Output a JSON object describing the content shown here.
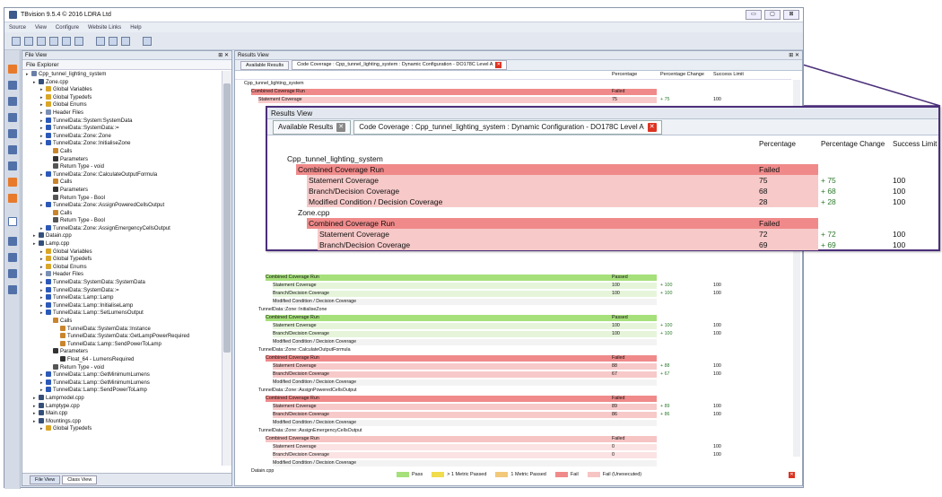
{
  "window": {
    "title": "TBvision 9.5.4 © 2016 LDRA Ltd",
    "buttons": [
      "▭",
      "▢",
      "⊠"
    ]
  },
  "menu": [
    "Source",
    "View",
    "Configure",
    "Website Links",
    "Help"
  ],
  "file_view": {
    "title": "File View",
    "explorer": "File Explorer",
    "tabs": [
      "File View",
      "Class View"
    ],
    "tree": [
      {
        "d": 0,
        "t": "Cpp_tunnel_lighting_system",
        "i": "project-icon",
        "c": "#6a7fa8"
      },
      {
        "d": 1,
        "t": "Zone.cpp",
        "i": "file-icon",
        "c": "#354f7a"
      },
      {
        "d": 2,
        "t": "Global Variables",
        "i": "folder-icon",
        "c": "#d9a628"
      },
      {
        "d": 2,
        "t": "Global Typedefs",
        "i": "folder-icon",
        "c": "#d9a628"
      },
      {
        "d": 2,
        "t": "Global Enums",
        "i": "folder-icon",
        "c": "#d9a628"
      },
      {
        "d": 2,
        "t": "Header Files",
        "i": "header-icon",
        "c": "#7b8fb3"
      },
      {
        "d": 2,
        "t": "TunnelData::System:SystemData",
        "i": "function-icon",
        "c": "#2c59b8"
      },
      {
        "d": 2,
        "t": "TunnelData::SystemData::=",
        "i": "function-icon",
        "c": "#2c59b8"
      },
      {
        "d": 2,
        "t": "TunnelData::Zone::Zone",
        "i": "function-icon",
        "c": "#2c59b8"
      },
      {
        "d": 2,
        "t": "TunnelData::Zone::InitialiseZone",
        "i": "function-icon",
        "c": "#2c59b8"
      },
      {
        "d": 3,
        "t": "Calls",
        "i": "calls-icon",
        "c": "#c9852c"
      },
      {
        "d": 3,
        "t": "Parameters",
        "i": "params-icon",
        "c": "#333"
      },
      {
        "d": 3,
        "t": "Return Type - void",
        "i": "return-icon",
        "c": "#555"
      },
      {
        "d": 2,
        "t": "TunnelData::Zone::CalculateOutputFormula",
        "i": "function-icon",
        "c": "#2c59b8"
      },
      {
        "d": 3,
        "t": "Calls",
        "i": "calls-icon",
        "c": "#c9852c"
      },
      {
        "d": 3,
        "t": "Parameters",
        "i": "params-icon",
        "c": "#333"
      },
      {
        "d": 3,
        "t": "Return Type - Bool",
        "i": "return-icon",
        "c": "#555"
      },
      {
        "d": 2,
        "t": "TunnelData::Zone::AssignPoweredCellsOutput",
        "i": "function-icon",
        "c": "#2c59b8"
      },
      {
        "d": 3,
        "t": "Calls",
        "i": "calls-icon",
        "c": "#c9852c"
      },
      {
        "d": 3,
        "t": "Return Type - Bool",
        "i": "return-icon",
        "c": "#555"
      },
      {
        "d": 2,
        "t": "TunnelData::Zone::AssignEmergencyCellsOutput",
        "i": "function-icon",
        "c": "#2c59b8"
      },
      {
        "d": 1,
        "t": "Datain.cpp",
        "i": "file-icon",
        "c": "#354f7a"
      },
      {
        "d": 1,
        "t": "Lamp.cpp",
        "i": "file-icon",
        "c": "#354f7a"
      },
      {
        "d": 2,
        "t": "Global Variables",
        "i": "folder-icon",
        "c": "#d9a628"
      },
      {
        "d": 2,
        "t": "Global Typedefs",
        "i": "folder-icon",
        "c": "#d9a628"
      },
      {
        "d": 2,
        "t": "Global Enums",
        "i": "folder-icon",
        "c": "#d9a628"
      },
      {
        "d": 2,
        "t": "Header Files",
        "i": "header-icon",
        "c": "#7b8fb3"
      },
      {
        "d": 2,
        "t": "TunnelData::SystemData::SystemData",
        "i": "function-icon",
        "c": "#2c59b8"
      },
      {
        "d": 2,
        "t": "TunnelData::SystemData::=",
        "i": "function-icon",
        "c": "#2c59b8"
      },
      {
        "d": 2,
        "t": "TunnelData::Lamp::Lamp",
        "i": "function-icon",
        "c": "#2c59b8"
      },
      {
        "d": 2,
        "t": "TunnelData::Lamp::InitialiseLamp",
        "i": "function-icon",
        "c": "#2c59b8"
      },
      {
        "d": 2,
        "t": "TunnelData::Lamp::SetLumensOutput",
        "i": "function-icon",
        "c": "#2c59b8"
      },
      {
        "d": 3,
        "t": "Calls",
        "i": "calls-icon",
        "c": "#c9852c"
      },
      {
        "d": 4,
        "t": "TunnelData::SystemData::Instance",
        "i": "call-icon",
        "c": "#c9852c"
      },
      {
        "d": 4,
        "t": "TunnelData::SystemData::GetLampPowerRequired",
        "i": "call-icon",
        "c": "#c9852c"
      },
      {
        "d": 4,
        "t": "TunnelData::Lamp::SendPowerToLamp",
        "i": "call-icon",
        "c": "#c9852c"
      },
      {
        "d": 3,
        "t": "Parameters",
        "i": "params-icon",
        "c": "#333"
      },
      {
        "d": 4,
        "t": "Float_64 - LumensRequired",
        "i": "param-icon",
        "c": "#333"
      },
      {
        "d": 3,
        "t": "Return Type - void",
        "i": "return-icon",
        "c": "#555"
      },
      {
        "d": 2,
        "t": "TunnelData::Lamp::GetMinimumLumens",
        "i": "function-icon",
        "c": "#2c59b8"
      },
      {
        "d": 2,
        "t": "TunnelData::Lamp::GetMinimumLumens",
        "i": "function-icon",
        "c": "#2c59b8"
      },
      {
        "d": 2,
        "t": "TunnelData::Lamp::SendPowerToLamp",
        "i": "function-icon",
        "c": "#2c59b8"
      },
      {
        "d": 1,
        "t": "Lampmodel.cpp",
        "i": "file-icon",
        "c": "#354f7a"
      },
      {
        "d": 1,
        "t": "Lamptype.cpp",
        "i": "file-icon",
        "c": "#354f7a"
      },
      {
        "d": 1,
        "t": "Main.cpp",
        "i": "file-icon",
        "c": "#354f7a"
      },
      {
        "d": 1,
        "t": "Mountings.cpp",
        "i": "file-icon",
        "c": "#354f7a"
      },
      {
        "d": 2,
        "t": "Global Typedefs",
        "i": "folder-icon",
        "c": "#d9a628"
      }
    ]
  },
  "results": {
    "title": "Results View",
    "tab_available": "Available Results",
    "tab_coverage": "Code Coverage : Cpp_tunnel_lighting_system : Dynamic Configuration - DO178C Level A",
    "col_percentage": "Percentage",
    "col_change": "Percentage Change",
    "col_limit": "Success Limit",
    "rows": [
      {
        "d": 0,
        "t": "Cpp_tunnel_lighting_system",
        "s": "none",
        "p": "",
        "c": "",
        "l": ""
      },
      {
        "d": 1,
        "t": "Combined Coverage Run",
        "s": "fail",
        "p": "Failed",
        "c": "",
        "l": ""
      },
      {
        "d": 2,
        "t": "Statement Coverage",
        "s": "failsub",
        "p": "75",
        "c": "+ 75",
        "l": "100"
      },
      {
        "d": 0,
        "t": "",
        "s": "none",
        "p": "",
        "c": "",
        "l": ""
      },
      {
        "d": 0,
        "t": "",
        "s": "none",
        "p": "",
        "c": "",
        "l": ""
      },
      {
        "d": 0,
        "t": "",
        "s": "none",
        "p": "",
        "c": "",
        "l": ""
      },
      {
        "d": 0,
        "t": "",
        "s": "none",
        "p": "",
        "c": "",
        "l": ""
      },
      {
        "d": 0,
        "t": "",
        "s": "none",
        "p": "",
        "c": "",
        "l": ""
      },
      {
        "d": 0,
        "t": "",
        "s": "none",
        "p": "",
        "c": "",
        "l": ""
      },
      {
        "d": 0,
        "t": "",
        "s": "none",
        "p": "",
        "c": "",
        "l": ""
      },
      {
        "d": 0,
        "t": "",
        "s": "none",
        "p": "",
        "c": "",
        "l": ""
      },
      {
        "d": 0,
        "t": "",
        "s": "none",
        "p": "",
        "c": "",
        "l": ""
      },
      {
        "d": 0,
        "t": "",
        "s": "none",
        "p": "",
        "c": "",
        "l": ""
      },
      {
        "d": 0,
        "t": "",
        "s": "none",
        "p": "",
        "c": "",
        "l": ""
      },
      {
        "d": 0,
        "t": "",
        "s": "none",
        "p": "",
        "c": "",
        "l": ""
      },
      {
        "d": 0,
        "t": "",
        "s": "none",
        "p": "",
        "c": "",
        "l": ""
      },
      {
        "d": 0,
        "t": "",
        "s": "none",
        "p": "",
        "c": "",
        "l": ""
      },
      {
        "d": 0,
        "t": "",
        "s": "none",
        "p": "",
        "c": "",
        "l": ""
      },
      {
        "d": 0,
        "t": "",
        "s": "none",
        "p": "",
        "c": "",
        "l": ""
      },
      {
        "d": 0,
        "t": "",
        "s": "none",
        "p": "",
        "c": "",
        "l": ""
      },
      {
        "d": 0,
        "t": "",
        "s": "none",
        "p": "",
        "c": "",
        "l": ""
      },
      {
        "d": 0,
        "t": "",
        "s": "none",
        "p": "",
        "c": "",
        "l": ""
      },
      {
        "d": 0,
        "t": "",
        "s": "none",
        "p": "",
        "c": "",
        "l": ""
      },
      {
        "d": 0,
        "t": "",
        "s": "none",
        "p": "",
        "c": "",
        "l": ""
      },
      {
        "d": 3,
        "t": "Combined Coverage Run",
        "s": "pass",
        "p": "Passed",
        "c": "",
        "l": ""
      },
      {
        "d": 4,
        "t": "Statement Coverage",
        "s": "passsub",
        "p": "100",
        "c": "+ 100",
        "l": "100"
      },
      {
        "d": 4,
        "t": "Branch/Decision Coverage",
        "s": "passsub",
        "p": "100",
        "c": "+ 100",
        "l": "100"
      },
      {
        "d": 4,
        "t": "Modified Condition / Decision Coverage",
        "s": "gray",
        "p": "",
        "c": "",
        "l": ""
      },
      {
        "d": 2,
        "t": "TunnelData::Zone::InitialiseZone",
        "s": "none",
        "p": "",
        "c": "",
        "l": ""
      },
      {
        "d": 3,
        "t": "Combined Coverage Run",
        "s": "pass",
        "p": "Passed",
        "c": "",
        "l": ""
      },
      {
        "d": 4,
        "t": "Statement Coverage",
        "s": "passsub",
        "p": "100",
        "c": "+ 100",
        "l": "100"
      },
      {
        "d": 4,
        "t": "Branch/Decision Coverage",
        "s": "passsub",
        "p": "100",
        "c": "+ 100",
        "l": "100"
      },
      {
        "d": 4,
        "t": "Modified Condition / Decision Coverage",
        "s": "gray",
        "p": "",
        "c": "",
        "l": ""
      },
      {
        "d": 2,
        "t": "TunnelData::Zone::CalculateOutputFormula",
        "s": "none",
        "p": "",
        "c": "",
        "l": ""
      },
      {
        "d": 3,
        "t": "Combined Coverage Run",
        "s": "fail",
        "p": "Failed",
        "c": "",
        "l": ""
      },
      {
        "d": 4,
        "t": "Statement Coverage",
        "s": "failsub",
        "p": "88",
        "c": "+ 88",
        "l": "100"
      },
      {
        "d": 4,
        "t": "Branch/Decision Coverage",
        "s": "failsub",
        "p": "67",
        "c": "+ 67",
        "l": "100"
      },
      {
        "d": 4,
        "t": "Modified Condition / Decision Coverage",
        "s": "gray",
        "p": "",
        "c": "",
        "l": ""
      },
      {
        "d": 2,
        "t": "TunnelData::Zone::AssignPoweredCellsOutput",
        "s": "none",
        "p": "",
        "c": "",
        "l": ""
      },
      {
        "d": 3,
        "t": "Combined Coverage Run",
        "s": "fail",
        "p": "Failed",
        "c": "",
        "l": ""
      },
      {
        "d": 4,
        "t": "Statement Coverage",
        "s": "failsub",
        "p": "89",
        "c": "+ 89",
        "l": "100"
      },
      {
        "d": 4,
        "t": "Branch/Decision Coverage",
        "s": "failsub",
        "p": "86",
        "c": "+ 86",
        "l": "100"
      },
      {
        "d": 4,
        "t": "Modified Condition / Decision Coverage",
        "s": "gray",
        "p": "",
        "c": "",
        "l": ""
      },
      {
        "d": 2,
        "t": "TunnelData::Zone::AssignEmergencyCellsOutput",
        "s": "none",
        "p": "",
        "c": "",
        "l": ""
      },
      {
        "d": 3,
        "t": "Combined Coverage Run",
        "s": "unexec",
        "p": "Failed",
        "c": "",
        "l": ""
      },
      {
        "d": 4,
        "t": "Statement Coverage",
        "s": "unexecsub",
        "p": "0",
        "c": "",
        "l": "100"
      },
      {
        "d": 4,
        "t": "Branch/Decision Coverage",
        "s": "unexecsub",
        "p": "0",
        "c": "",
        "l": "100"
      },
      {
        "d": 4,
        "t": "Modified Condition / Decision Coverage",
        "s": "gray",
        "p": "",
        "c": "",
        "l": ""
      },
      {
        "d": 1,
        "t": "Datain.cpp",
        "s": "none",
        "p": "",
        "c": "",
        "l": ""
      }
    ],
    "legend": [
      {
        "label": "Pass",
        "color": "#a6e07a"
      },
      {
        "label": "> 1 Metric Passed",
        "color": "#f0dc4c"
      },
      {
        "label": "1 Metric Passed",
        "color": "#f2c879"
      },
      {
        "label": "Fail",
        "color": "#f08a8a"
      },
      {
        "label": "Fail (Unexecuted)",
        "color": "#f7c4c4"
      }
    ]
  },
  "zoom": {
    "title": "Results View",
    "tab_available": "Available Results",
    "tab_coverage": "Code Coverage : Cpp_tunnel_lighting_system : Dynamic Configuration - DO178C Level A",
    "col_percentage": "Percentage",
    "col_change": "Percentage Change",
    "col_limit": "Success Limit",
    "rows": [
      {
        "d": 0,
        "t": "Cpp_tunnel_lighting_system",
        "s": "none",
        "p": "",
        "c": "",
        "l": ""
      },
      {
        "d": 1,
        "t": "Combined Coverage Run",
        "s": "fail",
        "p": "Failed",
        "c": "",
        "l": ""
      },
      {
        "d": 2,
        "t": "Statement Coverage",
        "s": "failsub",
        "p": "75",
        "c": "+ 75",
        "l": "100"
      },
      {
        "d": 2,
        "t": "Branch/Decision Coverage",
        "s": "failsub",
        "p": "68",
        "c": "+ 68",
        "l": "100"
      },
      {
        "d": 2,
        "t": "Modified Condition / Decision Coverage",
        "s": "failsub",
        "p": "28",
        "c": "+ 28",
        "l": "100"
      },
      {
        "d": 1,
        "t": "Zone.cpp",
        "s": "none",
        "p": "",
        "c": "",
        "l": ""
      },
      {
        "d": 2,
        "t": "Combined Coverage Run",
        "s": "fail",
        "p": "Failed",
        "c": "",
        "l": ""
      },
      {
        "d": 3,
        "t": "Statement Coverage",
        "s": "failsub",
        "p": "72",
        "c": "+ 72",
        "l": "100"
      },
      {
        "d": 3,
        "t": "Branch/Decision Coverage",
        "s": "failsub",
        "p": "69",
        "c": "+ 69",
        "l": "100"
      }
    ]
  },
  "colors": {
    "fail": "#f08a8a",
    "failsub": "#f7c9c9",
    "pass": "#a6e07a",
    "passsub": "#e6f5da",
    "unexec": "#f7c4c4",
    "accent": "#4b2f7a"
  }
}
